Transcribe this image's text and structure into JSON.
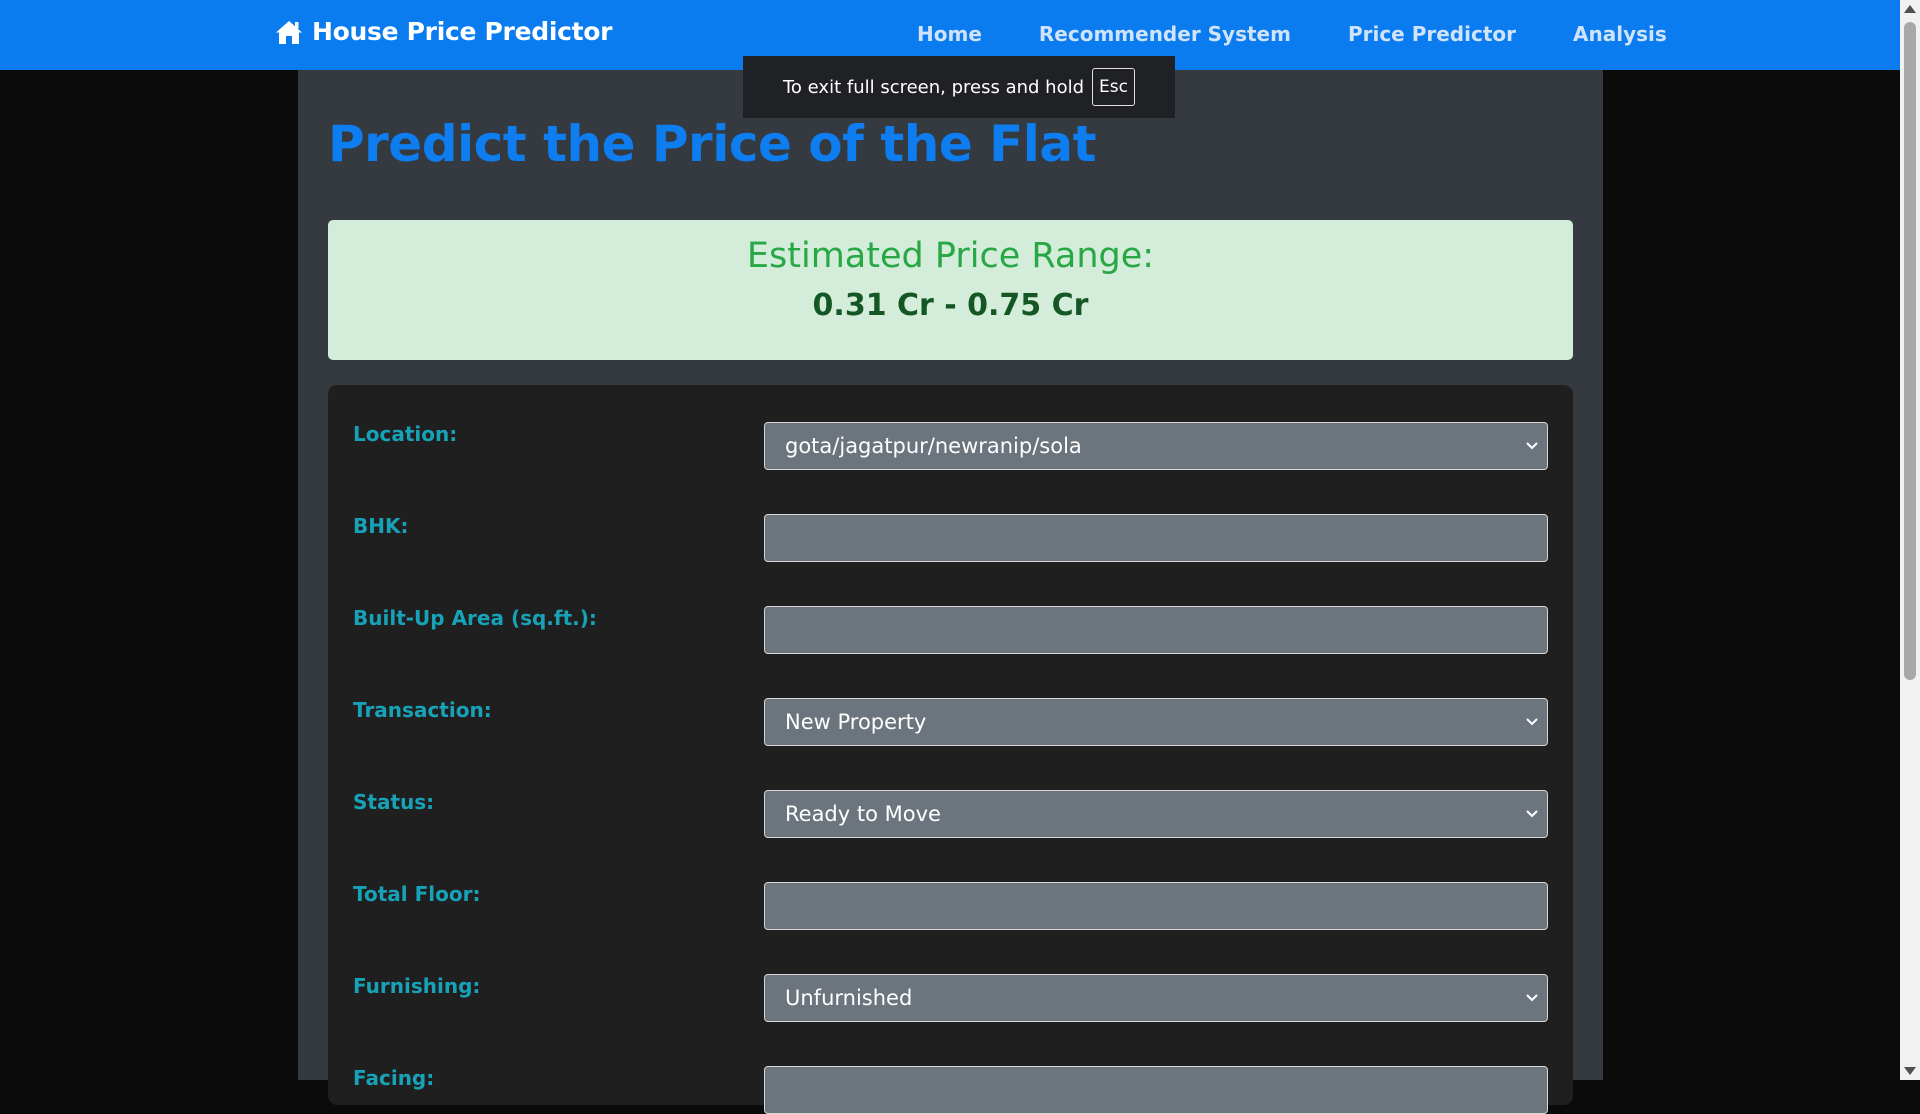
{
  "navbar": {
    "brand": "House Price Predictor",
    "brand_icon": "home-icon",
    "links": [
      "Home",
      "Recommender System",
      "Price Predictor",
      "Analysis"
    ]
  },
  "fullscreen_notice": {
    "text": "To exit full screen, press and hold",
    "key": "Esc"
  },
  "main": {
    "title": "Predict the Price of the Flat",
    "result": {
      "heading": "Estimated Price Range:",
      "value": "0.31 Cr - 0.75 Cr"
    },
    "form": {
      "location": {
        "label": "Location:",
        "value": "gota/jagatpur/newranip/sola"
      },
      "bhk": {
        "label": "BHK:",
        "value": ""
      },
      "area": {
        "label": "Built-Up Area (sq.ft.):",
        "value": ""
      },
      "transaction": {
        "label": "Transaction:",
        "value": "New Property"
      },
      "status": {
        "label": "Status:",
        "value": "Ready to Move"
      },
      "total_floor": {
        "label": "Total Floor:",
        "value": ""
      },
      "furnishing": {
        "label": "Furnishing:",
        "value": "Unfurnished"
      },
      "facing": {
        "label": "Facing:",
        "value": ""
      }
    }
  },
  "colors": {
    "navbar": "#0a7cf0",
    "title": "#0d7df0",
    "label": "#17a2b8",
    "result_bg": "#d4edda",
    "result_heading": "#28a745",
    "result_value": "#155724"
  }
}
